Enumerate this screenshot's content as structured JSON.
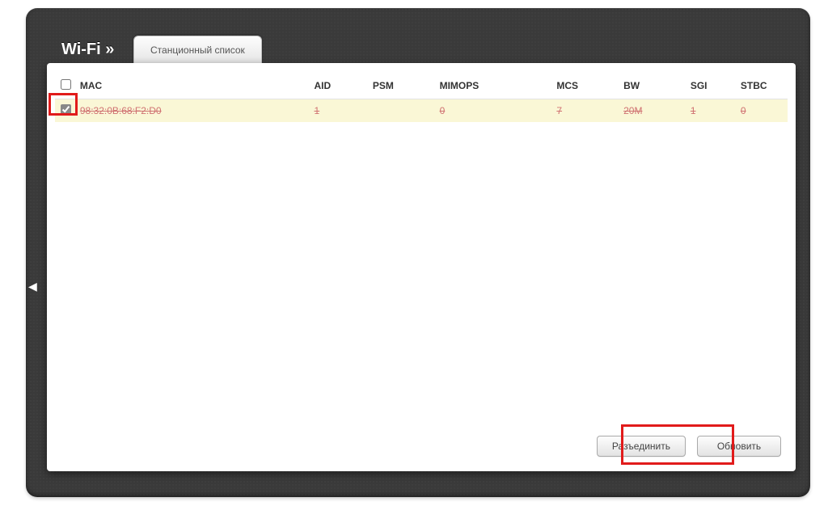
{
  "breadcrumb": {
    "title": "Wi-Fi »"
  },
  "tab": {
    "active_label": "Станционный список"
  },
  "table": {
    "headers": {
      "select": "",
      "mac": "MAC",
      "aid": "AID",
      "psm": "PSM",
      "mimops": "MIMOPS",
      "mcs": "MCS",
      "bw": "BW",
      "sgi": "SGI",
      "stbc": "STBC"
    },
    "header_checkbox_checked": false,
    "rows": [
      {
        "checked": true,
        "selected_for_removal": true,
        "mac": "98:32:0B:68:F2:D0",
        "aid": "1",
        "psm": "",
        "mimops": "0",
        "mcs": "7",
        "bw": "20M",
        "sgi": "1",
        "stbc": "0"
      }
    ]
  },
  "buttons": {
    "disconnect": "Разъединить",
    "refresh": "Обновить"
  },
  "icons": {
    "collapse_arrow": "◀"
  },
  "highlights": {
    "row_checkbox": true,
    "disconnect_button": true
  }
}
